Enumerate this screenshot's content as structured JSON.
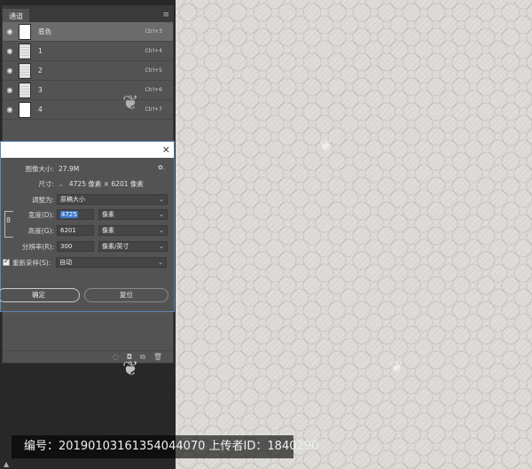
{
  "channels_panel": {
    "tab_label": "通道",
    "menu_icon": "hamburger-icon",
    "rows": [
      {
        "name": "底色",
        "shortcut": "Ctrl+3",
        "selected": true,
        "thumb": "white"
      },
      {
        "name": "1",
        "shortcut": "Ctrl+4",
        "selected": false,
        "thumb": "gray"
      },
      {
        "name": "2",
        "shortcut": "Ctrl+5",
        "selected": false,
        "thumb": "gray"
      },
      {
        "name": "3",
        "shortcut": "Ctrl+6",
        "selected": false,
        "thumb": "gray"
      },
      {
        "name": "4",
        "shortcut": "Ctrl+7",
        "selected": false,
        "thumb": "white"
      }
    ],
    "footer_icons": [
      "dotted-circle-icon",
      "mask-icon",
      "new-channel-icon",
      "trash-icon"
    ]
  },
  "dialog": {
    "close": "×",
    "image_size_label": "图像大小:",
    "image_size_value": "27.9M",
    "gear": "✿.",
    "dimensions_label": "尺寸:",
    "dimensions_arrow": "⌄",
    "dimensions_value": "4725 像素 × 6201 像素",
    "fit_label": "调整为:",
    "fit_value": "原稿大小",
    "width_label": "宽度(D):",
    "width_value": "4725",
    "width_unit": "像素",
    "height_label": "高度(G):",
    "height_value": "6201",
    "height_unit": "像素",
    "resolution_label": "分辨率(R):",
    "resolution_value": "300",
    "resolution_unit": "像素/英寸",
    "resample_label": "重新采样(S):",
    "resample_value": "自动",
    "resample_checked": true,
    "ok_label": "确定",
    "reset_label": "复位"
  },
  "info_bar": {
    "text": "编号：20190103161354044070 上传者ID：1840290"
  },
  "colors": {
    "panel_bg": "#535353",
    "dialog_border": "#5f86b8",
    "highlight": "#3b78c9",
    "canvas": "#dddbd6"
  }
}
